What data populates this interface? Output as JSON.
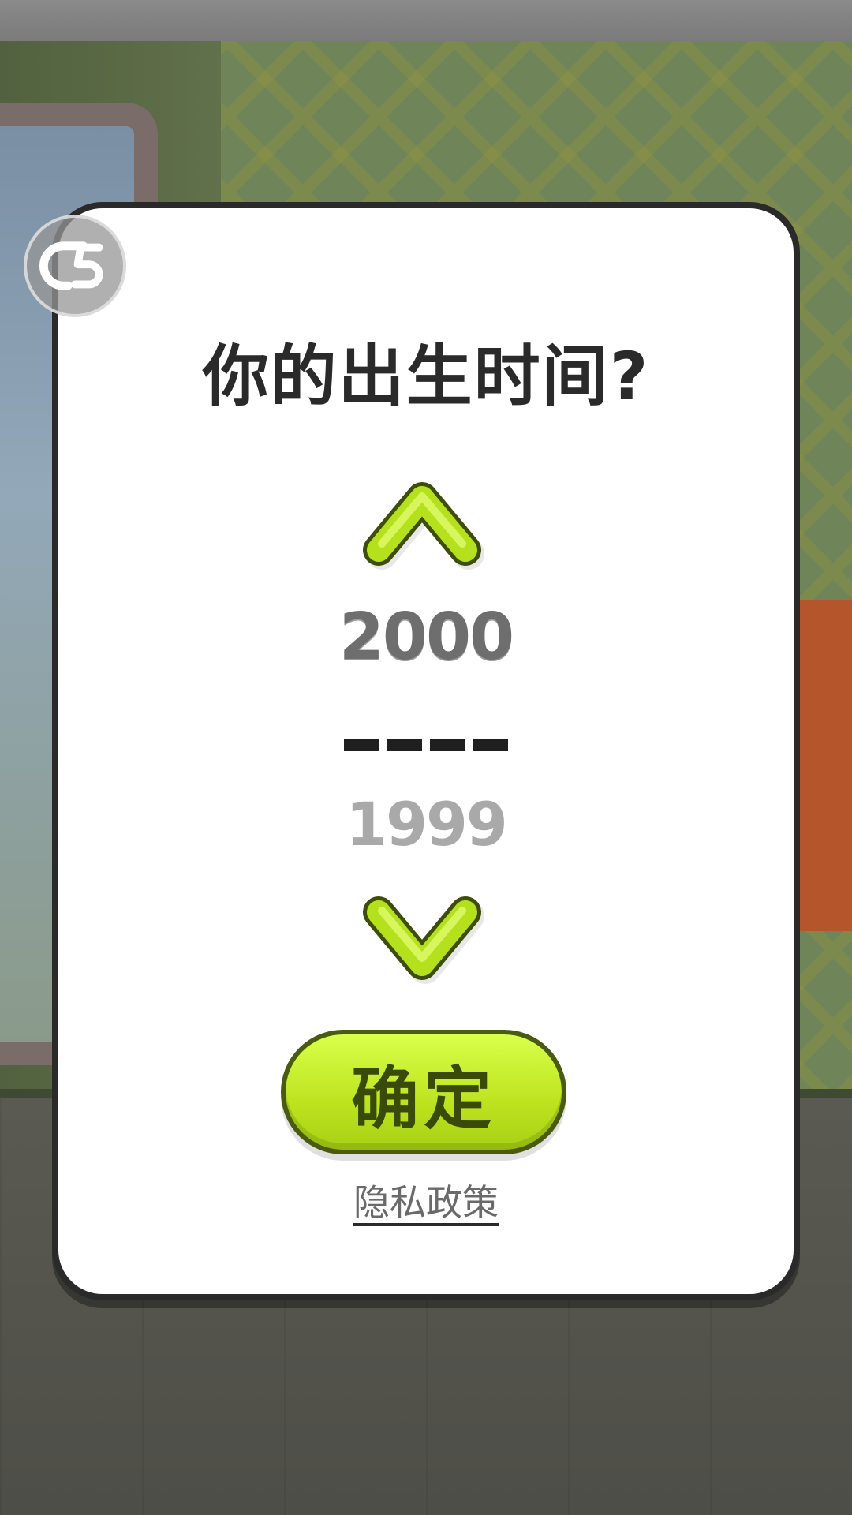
{
  "dialog": {
    "title": "你的出生时间?",
    "year_current": "2000",
    "year_next": "1999",
    "confirm_label": "确定",
    "privacy_label": "隐私政策"
  },
  "icons": {
    "logo": "c5-logo-icon",
    "up": "chevron-up-icon",
    "down": "chevron-down-icon"
  },
  "colors": {
    "accent": "#c5ef2b",
    "accent_dark": "#4a5a10",
    "card_bg": "#ffffff",
    "card_border": "#2a2a2a"
  }
}
